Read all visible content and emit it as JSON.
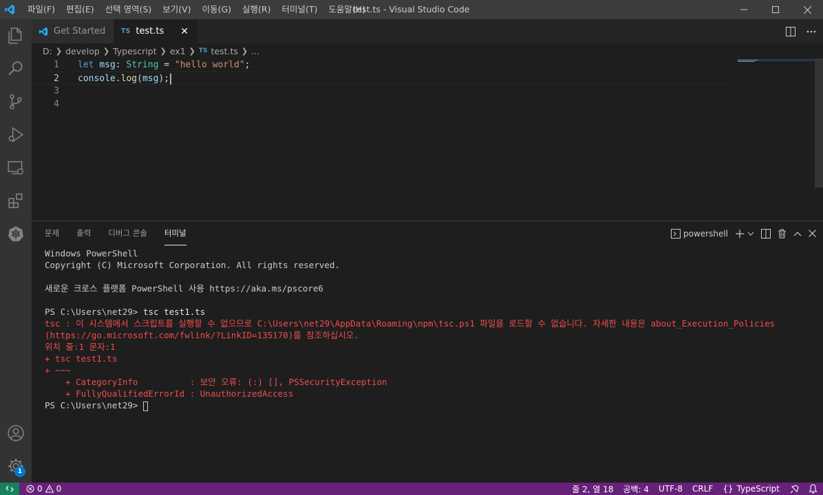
{
  "window": {
    "title": "test.ts - Visual Studio Code"
  },
  "menu": [
    {
      "label": "파일(F)"
    },
    {
      "label": "편집(E)"
    },
    {
      "label": "선택 영역(S)"
    },
    {
      "label": "보기(V)"
    },
    {
      "label": "이동(G)"
    },
    {
      "label": "실행(R)"
    },
    {
      "label": "터미널(T)"
    },
    {
      "label": "도움말(H)"
    }
  ],
  "tabs": {
    "get_started": "Get Started",
    "test_ts": "test.ts",
    "ts_badge": "TS",
    "close": "✕"
  },
  "breadcrumb": {
    "drive": "D:",
    "folder1": "develop",
    "folder2": "Typescript",
    "folder3": "ex1",
    "file": "test.ts",
    "more": "...",
    "ts_badge": "TS"
  },
  "editor": {
    "line_numbers": [
      "1",
      "2",
      "3",
      "4"
    ],
    "line1": {
      "kw": "let",
      "var": "msg",
      "colon": ": ",
      "type": "String",
      "eq": " = ",
      "str": "\"hello world\"",
      "end": ";"
    },
    "line2": {
      "obj": "console",
      "dot": ".",
      "fn": "log",
      "open": "(",
      "arg": "msg",
      "close": ");"
    }
  },
  "panel": {
    "tabs": [
      {
        "label": "문제"
      },
      {
        "label": "출력"
      },
      {
        "label": "디버그 콘솔"
      },
      {
        "label": "터미널"
      }
    ],
    "terminal_name": "powershell"
  },
  "terminal": {
    "l1": "Windows PowerShell",
    "l2": "Copyright (C) Microsoft Corporation. All rights reserved.",
    "l3": "새로운 크로스 플랫폼 PowerShell 사용 https://aka.ms/pscore6",
    "prompt": "PS C:\\Users\\net29> ",
    "cmd": "tsc test1.ts",
    "e1": "tsc : 이 시스템에서 스크립트를 실행할 수 없으므로 C:\\Users\\net29\\AppData\\Roaming\\npm\\tsc.ps1 파일을 로드할 수 없습니다. 자세한 내용은 about_Execution_Policies",
    "e2": "(https://go.microsoft.com/fwlink/?LinkID=135170)를 참조하십시오.",
    "e3": "위치 줄:1 문자:1",
    "e4": "+ tsc test1.ts",
    "e5": "+ ~~~",
    "e6": "    + CategoryInfo          : 보안 오류: (:) [], PSSecurityException",
    "e7": "    + FullyQualifiedErrorId : UnauthorizedAccess",
    "prompt2": "PS C:\\Users\\net29> "
  },
  "status": {
    "errors": "0",
    "warnings": "0",
    "position": "줄 2, 열 18",
    "spaces": "공백: 4",
    "encoding": "UTF-8",
    "eol": "CRLF",
    "language": "TypeScript",
    "braces": "{}"
  },
  "activity_badge": "1",
  "colors": {
    "statusbar": "#68217a",
    "activitybar": "#333333",
    "editor": "#1e1e1e",
    "error_text": "#f14c4c"
  }
}
